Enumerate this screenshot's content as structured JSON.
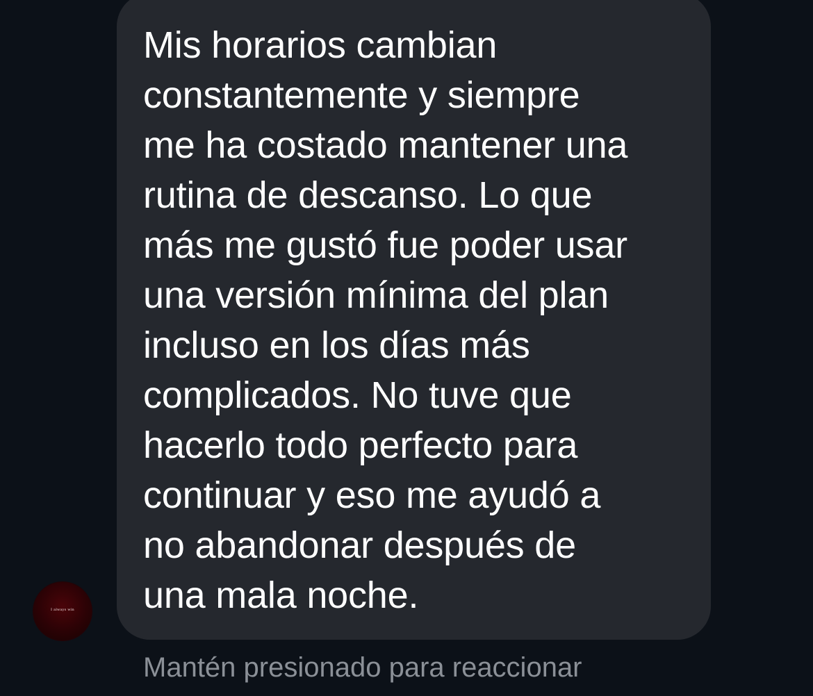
{
  "conversation": {
    "avatar": {
      "icon": "profile-avatar",
      "caption": "I always win",
      "color": "#3a0307"
    },
    "message": {
      "text": "Mis horarios cambian\nconstantemente y siempre\nme ha costado mantener una\nrutina de descanso. Lo que\nmás me gustó fue poder usar\nuna versión mínima del plan\nincluso en los días más\ncomplicados. No tuve que\nhacerlo todo perfecto para\ncontinuar y eso me ayudó a\nno abandonar después de\nuna mala noche.",
      "bubble_color": "#25282e"
    },
    "reaction_hint": "Mantén presionado para reaccionar"
  }
}
